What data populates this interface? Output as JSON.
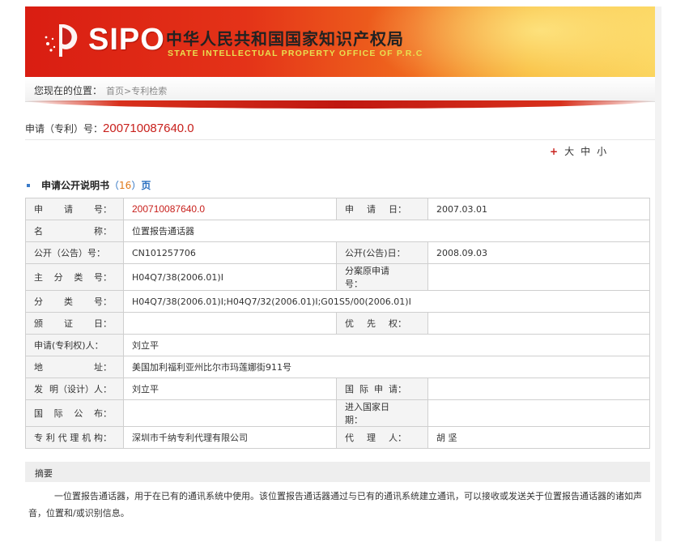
{
  "header": {
    "logo_text": "SIPO",
    "cn_title": "中华人民共和国国家知识产权局",
    "en_title": "STATE INTELLECTUAL PROPERTY OFFICE OF P.R.C"
  },
  "breadcrumb": {
    "label": "您现在的位置：",
    "home": "首页",
    "sep": ">",
    "current": "专利检索"
  },
  "application": {
    "label": "申请（专利）号：",
    "number": "200710087640.0"
  },
  "font_size": {
    "plus": "+",
    "large": "大",
    "medium": "中",
    "small": "小"
  },
  "section": {
    "title": "申请公开说明书",
    "paren_open": "（",
    "pages": "16",
    "paren_close": "）",
    "unit": "页"
  },
  "rows": [
    {
      "k1": [
        "申",
        "请",
        "号："
      ],
      "v1": "200710087640.0",
      "v1_red": true,
      "k2": [
        "申",
        "请",
        "日："
      ],
      "v2": "2007.03.01"
    },
    {
      "k1": [
        "名",
        "称："
      ],
      "v1": "位置报告通话器",
      "span": true
    },
    {
      "k1": [
        "公开（公告）号："
      ],
      "v1": "CN101257706",
      "k2": [
        "公开(公告)日："
      ],
      "v2": "2008.09.03"
    },
    {
      "k1": [
        "主",
        "分",
        "类",
        "号："
      ],
      "v1": "H04Q7/38(2006.01)I",
      "k2": [
        "分案原申请号："
      ],
      "v2": ""
    },
    {
      "k1": [
        "分",
        "类",
        "号："
      ],
      "v1": "H04Q7/38(2006.01)I;H04Q7/32(2006.01)I;G01S5/00(2006.01)I",
      "span": true
    },
    {
      "k1": [
        "颁",
        "证",
        "日："
      ],
      "v1": "",
      "k2": [
        "优",
        "先",
        "权："
      ],
      "v2": ""
    },
    {
      "k1": [
        "申请(专利权)人："
      ],
      "v1": "刘立平",
      "span": true
    },
    {
      "k1": [
        "地",
        "址："
      ],
      "v1": "美国加利福利亚州比尔市玛莲娜街911号",
      "span": true
    },
    {
      "k1": [
        "发",
        "明（设计）人："
      ],
      "v1": "刘立平",
      "k2": [
        "国",
        "际",
        "申",
        "请："
      ],
      "v2": ""
    },
    {
      "k1": [
        "国",
        "际",
        "公",
        "布："
      ],
      "v1": "",
      "k2": [
        "进入国家日期："
      ],
      "v2": ""
    },
    {
      "k1": [
        "专",
        "利",
        "代",
        "理",
        "机",
        "构："
      ],
      "v1": "深圳市千纳专利代理有限公司",
      "k2": [
        "代",
        "理",
        "人："
      ],
      "v2": "胡 坚"
    }
  ],
  "abstract": {
    "heading": "摘要",
    "text": "一位置报告通话器，用于在已有的通讯系统中使用。该位置报告通话器通过与已有的通讯系统建立通讯，可以接收或发送关于位置报告通话器的诸如声音，位置和/或识别信息。"
  },
  "colors": {
    "accent_red": "#c8201c",
    "link_blue": "#2a6fc0",
    "page_orange": "#e07a1a"
  }
}
